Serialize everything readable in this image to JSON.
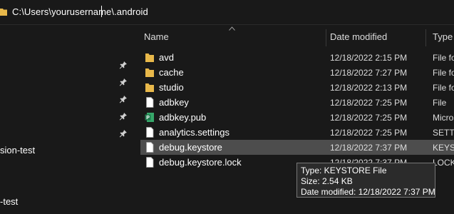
{
  "address": {
    "path": "C:\\Users\\yourusername\\.android",
    "icon": "folder-icon"
  },
  "nav": {
    "pins": [
      "pin-icon",
      "pin-icon",
      "pin-icon",
      "pin-icon",
      "pin-icon"
    ],
    "items": [
      {
        "label": "sion-test"
      },
      {
        "label": "-test"
      }
    ]
  },
  "columns": {
    "name": "Name",
    "date": "Date modified",
    "type": "Type"
  },
  "files": [
    {
      "name": "avd",
      "date": "12/18/2022 2:15 PM",
      "type": "File folder",
      "icon": "folder-icon"
    },
    {
      "name": "cache",
      "date": "12/18/2022 7:27 PM",
      "type": "File folder",
      "icon": "folder-icon"
    },
    {
      "name": "studio",
      "date": "12/18/2022 2:13 PM",
      "type": "File folder",
      "icon": "folder-icon"
    },
    {
      "name": "adbkey",
      "date": "12/18/2022 7:25 PM",
      "type": "File",
      "icon": "file-icon"
    },
    {
      "name": "adbkey.pub",
      "date": "12/18/2022 7:25 PM",
      "type": "Microsoft Publisher Document",
      "icon": "publisher-icon"
    },
    {
      "name": "analytics.settings",
      "date": "12/18/2022 7:25 PM",
      "type": "SETTINGS File",
      "icon": "file-icon"
    },
    {
      "name": "debug.keystore",
      "date": "12/18/2022 7:37 PM",
      "type": "KEYSTORE File",
      "icon": "file-icon",
      "selected": true
    },
    {
      "name": "debug.keystore.lock",
      "date": "12/18/2022 7:37 PM",
      "type": "LOCK File",
      "icon": "file-icon"
    }
  ],
  "tooltip": {
    "type_line": "Type: KEYSTORE File",
    "size_line": "Size: 2.54 KB",
    "date_line": "Date modified: 12/18/2022 7:37 PM"
  },
  "colors": {
    "background": "#191919",
    "folder": "#e8b84a",
    "selected_row": "#4d4d4d",
    "publisher": "#1f7a4d"
  }
}
